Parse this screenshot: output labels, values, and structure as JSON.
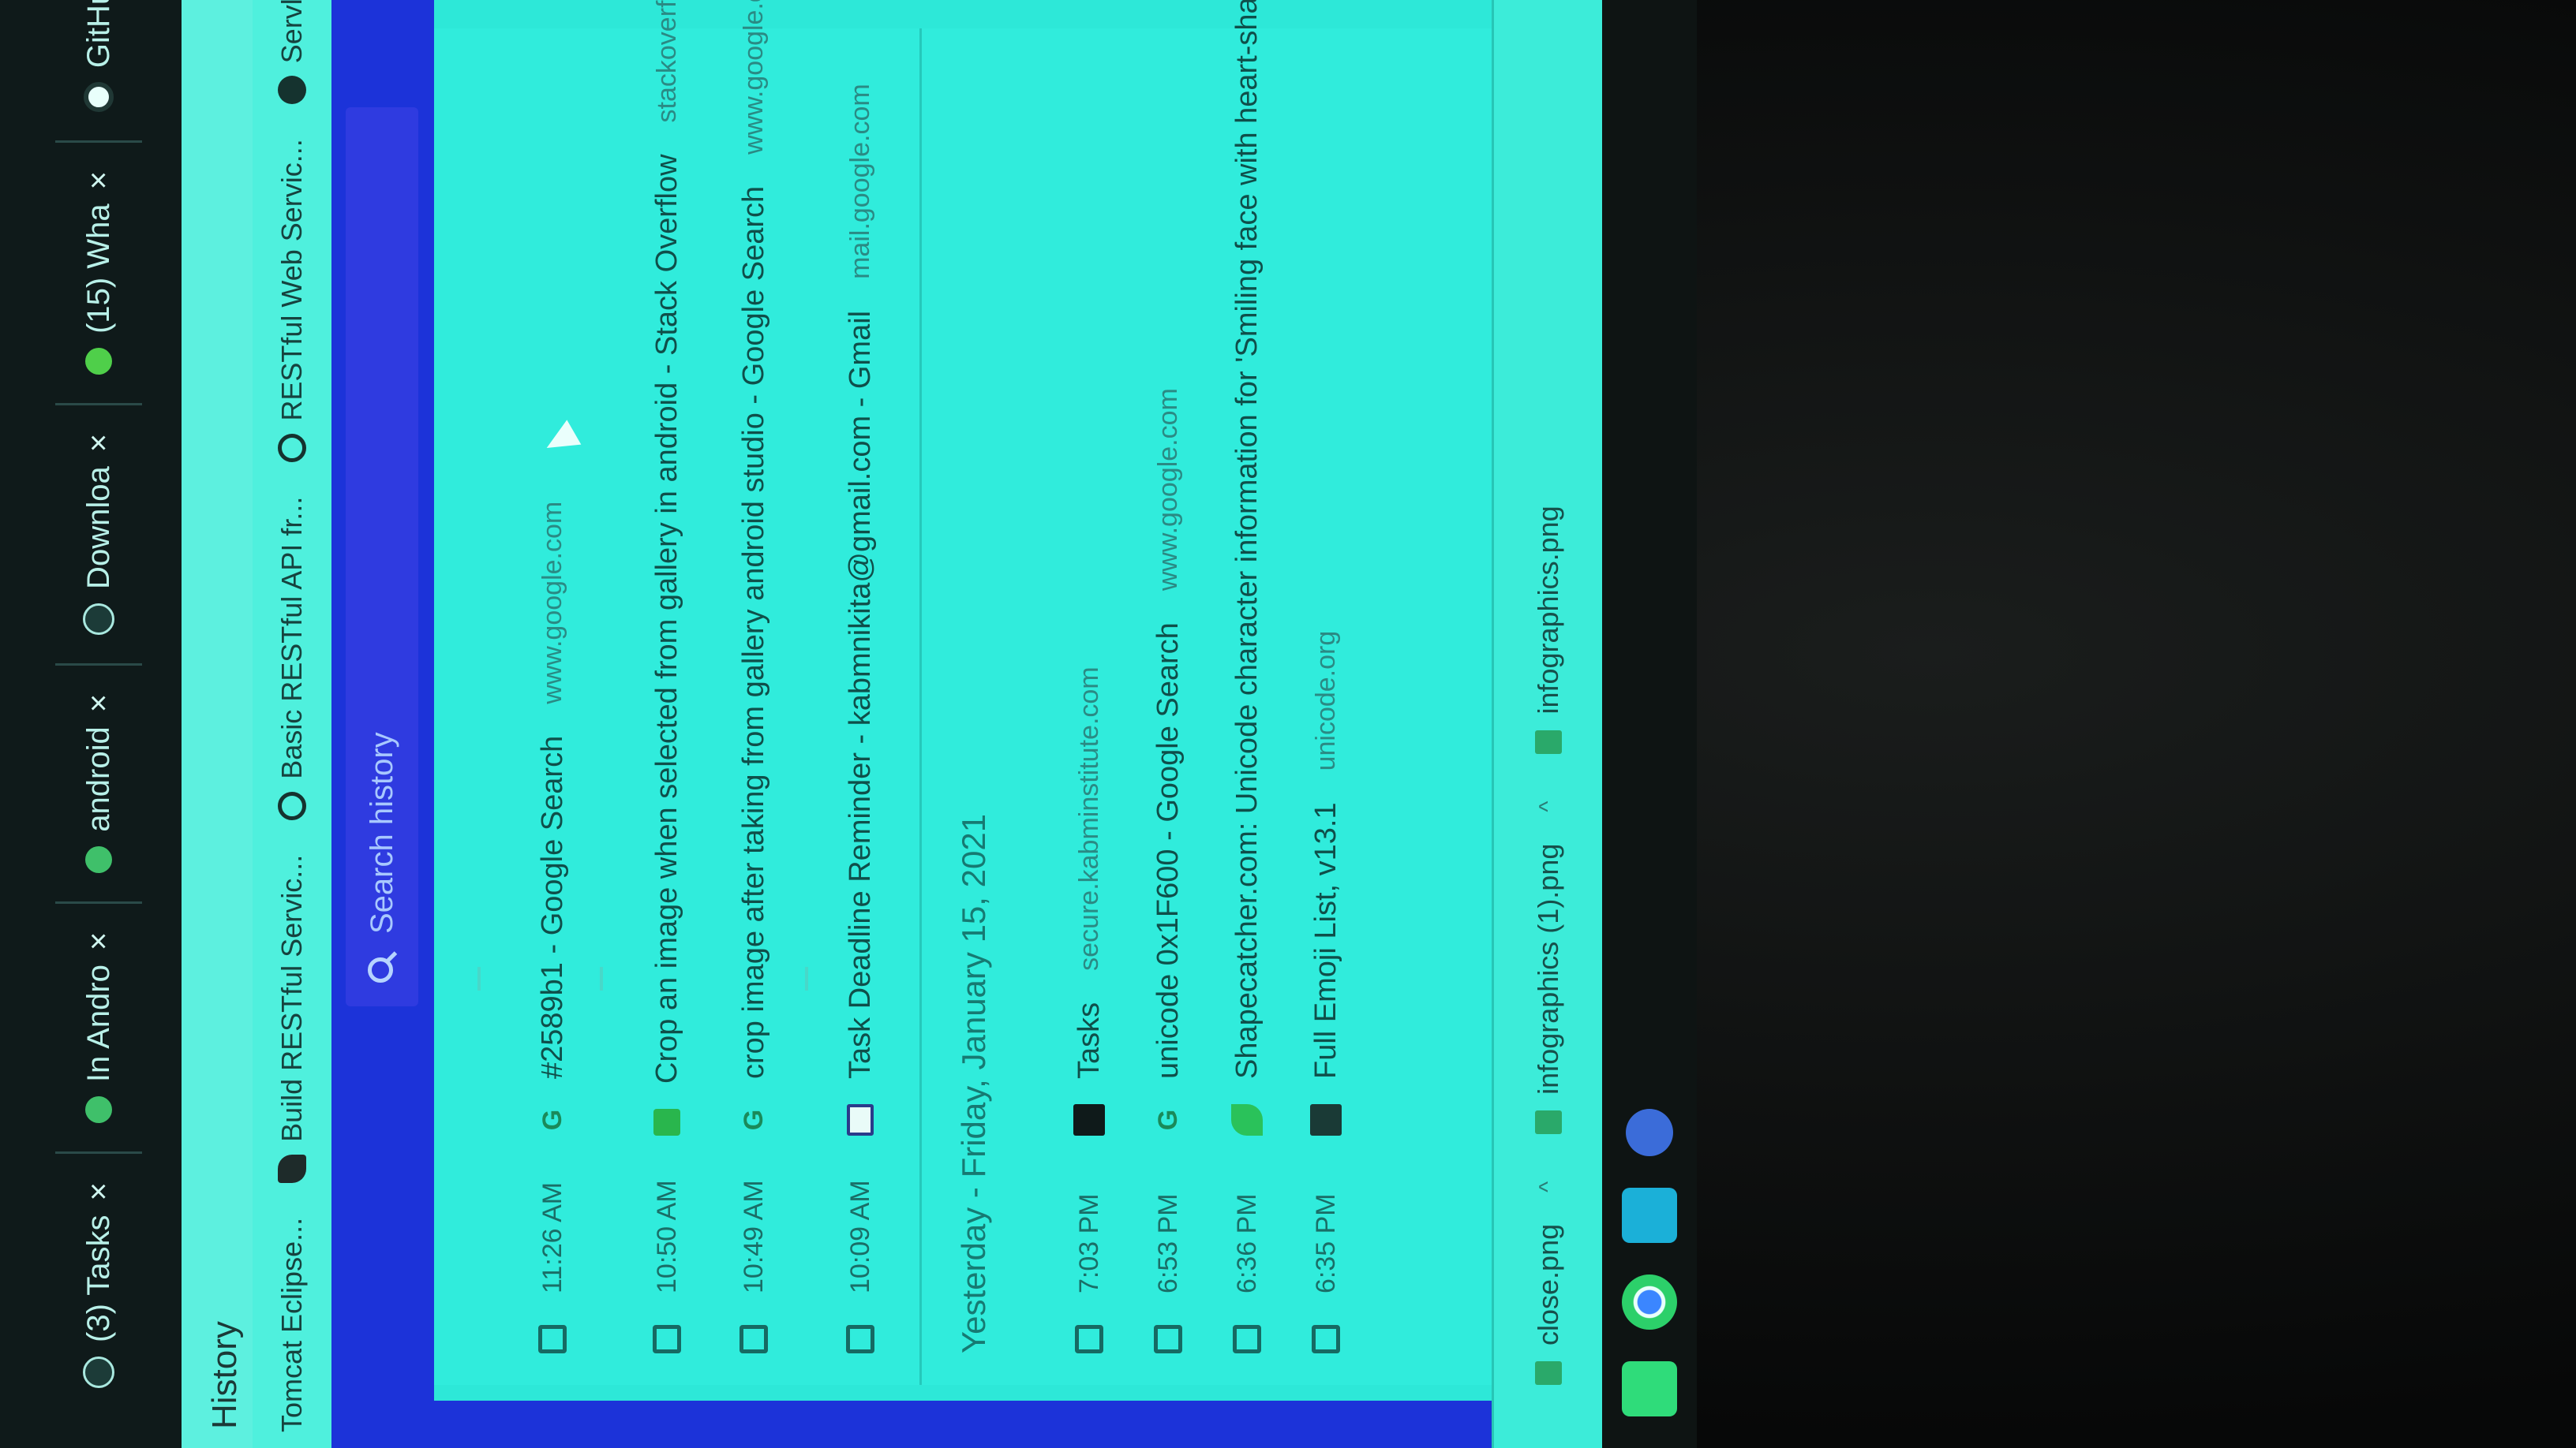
{
  "browser": {
    "tabs": [
      {
        "label": "(3) Tasks",
        "icon": "tasks-icon"
      },
      {
        "label": "In Andro",
        "icon": "android-icon"
      },
      {
        "label": "android",
        "icon": "android-icon"
      },
      {
        "label": "Downloa",
        "icon": "download-icon"
      },
      {
        "label": "(15) Wha",
        "icon": "whatsapp-icon"
      },
      {
        "label": "GitHub",
        "icon": "github-icon"
      }
    ],
    "close_glyph": "×",
    "page_title": "History"
  },
  "bookmarks": [
    {
      "label": "Tomcat Eclipse...",
      "icon": "bookmark-icon"
    },
    {
      "label": "Build RESTful Servic...",
      "icon": "bird-icon"
    },
    {
      "label": "Basic RESTful API fr...",
      "icon": "github-icon"
    },
    {
      "label": "RESTful Web Servic...",
      "icon": "globe-icon"
    },
    {
      "label": "Servlet Database C...",
      "icon": "dot-icon"
    }
  ],
  "search": {
    "placeholder": "Search history"
  },
  "history": {
    "today_rows": [
      {
        "time": "11:26 AM",
        "title": "#2589b1 - Google Search",
        "domain": "www.google.com",
        "favicon": "google-icon"
      },
      {
        "time": "10:50 AM",
        "title": "Crop an image when selected from gallery in android - Stack Overflow",
        "domain": "stackoverflow.com",
        "favicon": "stackoverflow-icon"
      },
      {
        "time": "10:49 AM",
        "title": "crop image after taking from gallery android studio - Google Search",
        "domain": "www.google.com",
        "favicon": "google-icon"
      },
      {
        "time": "10:09 AM",
        "title": "Task Deadline Reminder - kabmnikita@gmail.com - Gmail",
        "domain": "mail.google.com",
        "favicon": "gmail-icon"
      }
    ],
    "yesterday_heading": "Yesterday - Friday, January 15, 2021",
    "yesterday_rows": [
      {
        "time": "7:03 PM",
        "title": "Tasks",
        "domain": "secure.kabminstitute.com",
        "favicon": "tasks-icon"
      },
      {
        "time": "6:53 PM",
        "title": "unicode 0x1F600 - Google Search",
        "domain": "www.google.com",
        "favicon": "google-icon"
      },
      {
        "time": "6:36 PM",
        "title": "Shapecatcher.com: Unicode character information for 'Smiling face with heart-shaped eyes' (Syst",
        "domain": "",
        "favicon": "leaf-icon"
      },
      {
        "time": "6:35 PM",
        "title": "Full Emoji List, v13.1",
        "domain": "unicode.org",
        "favicon": "unicode-icon"
      }
    ]
  },
  "downloads": [
    {
      "name": "close.png"
    },
    {
      "name": "infographics (1).png"
    },
    {
      "name": "infographics.png"
    }
  ]
}
